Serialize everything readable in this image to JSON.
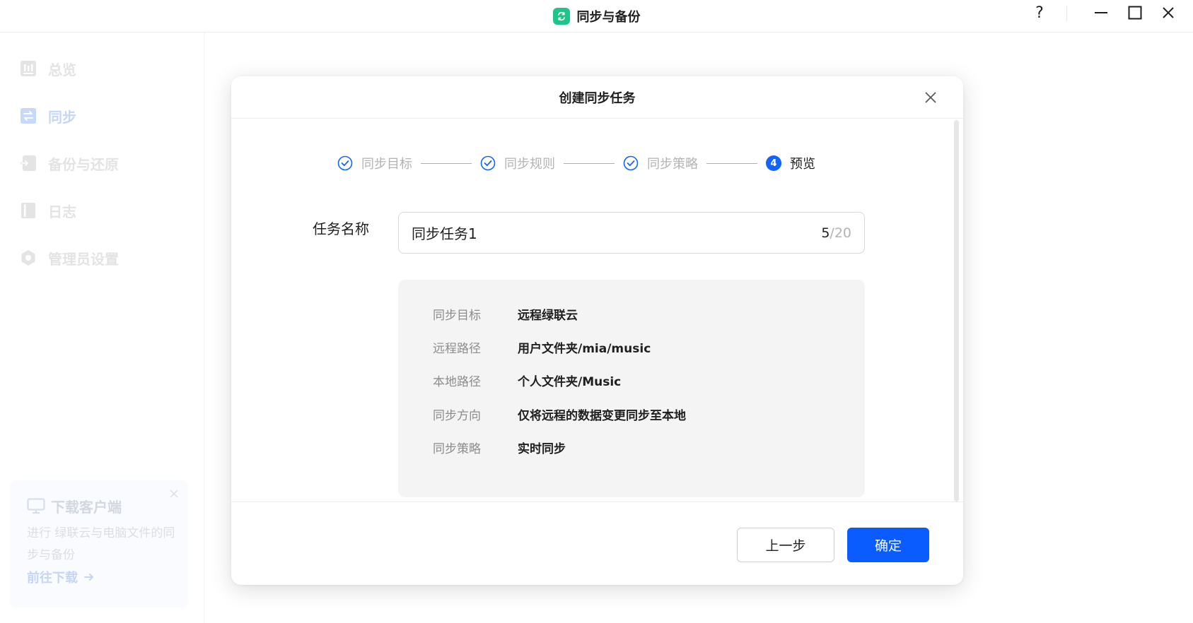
{
  "window": {
    "title": "同步与备份",
    "help_label": "?"
  },
  "sidebar": {
    "items": [
      {
        "label": "总览",
        "icon": "overview-icon",
        "active": false
      },
      {
        "label": "同步",
        "icon": "sync-icon",
        "active": true
      },
      {
        "label": "备份与还原",
        "icon": "backup-icon",
        "active": false
      },
      {
        "label": "日志",
        "icon": "log-icon",
        "active": false
      },
      {
        "label": "管理员设置",
        "icon": "gear-icon",
        "active": false
      }
    ],
    "download_card": {
      "title": "下载客户端",
      "description": "进行 绿联云与电脑文件的同步与备份",
      "link": "前往下载"
    }
  },
  "modal": {
    "title": "创建同步任务",
    "steps": [
      {
        "label": "同步目标",
        "status": "done"
      },
      {
        "label": "同步规则",
        "status": "done"
      },
      {
        "label": "同步策略",
        "status": "done"
      },
      {
        "label": "预览",
        "status": "current",
        "number": "4"
      }
    ],
    "task_name": {
      "label": "任务名称",
      "value": "同步任务1",
      "count": "5",
      "max": "/20"
    },
    "preview": [
      {
        "key": "同步目标",
        "value": "远程绿联云"
      },
      {
        "key": "远程路径",
        "value": "用户文件夹/mia/music"
      },
      {
        "key": "本地路径",
        "value": "个人文件夹/Music"
      },
      {
        "key": "同步方向",
        "value": "仅将远程的数据变更同步至本地"
      },
      {
        "key": "同步策略",
        "value": "实时同步"
      }
    ],
    "buttons": {
      "prev": "上一步",
      "confirm": "确定"
    }
  },
  "colors": {
    "primary": "#0a5cff",
    "step_blue": "#1463ff",
    "app_logo": "#1fc48a",
    "sidebar_active": "#a7c1f5"
  }
}
